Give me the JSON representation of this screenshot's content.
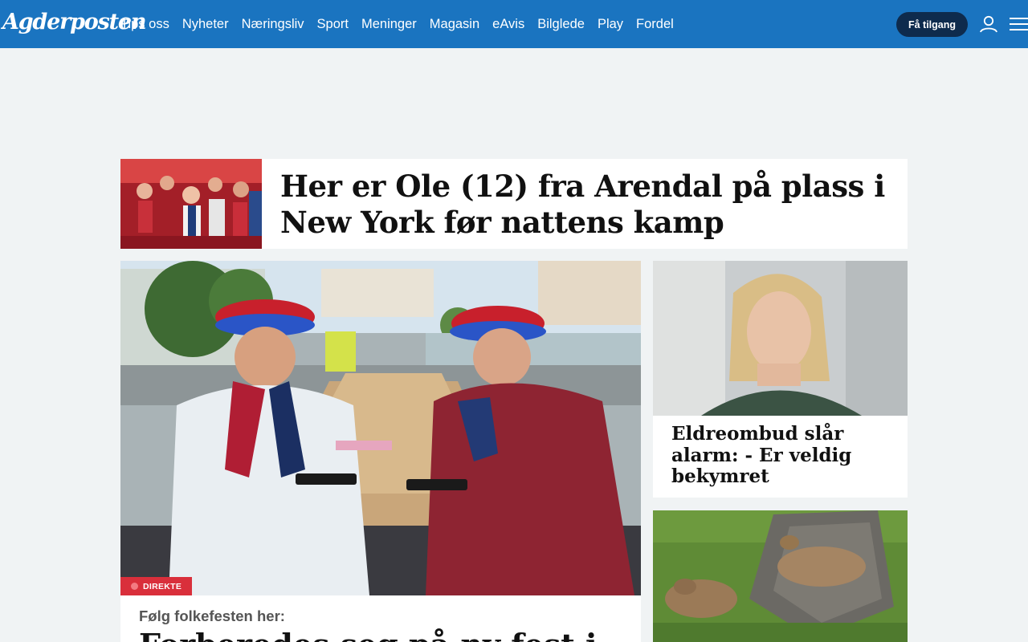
{
  "header": {
    "logo": "Agderposten",
    "nav": [
      "Tips oss",
      "Nyheter",
      "Næringsliv",
      "Sport",
      "Meninger",
      "Magasin",
      "eAvis",
      "Bilglede",
      "Play",
      "Fordel"
    ],
    "cta_label": "Få tilgang",
    "brand_color": "#1a74c0"
  },
  "stories": {
    "top": {
      "headline": "Her er Ole (12) fra Arendal på plass i New York før nattens kamp"
    },
    "main": {
      "badge": "DIREKTE",
      "kicker": "Følg folkefesten her:",
      "headline": "Forberedes seg på ny fest i"
    },
    "side1": {
      "headline": "Eldreombud slår alarm: - Er veldig bekymret"
    }
  }
}
